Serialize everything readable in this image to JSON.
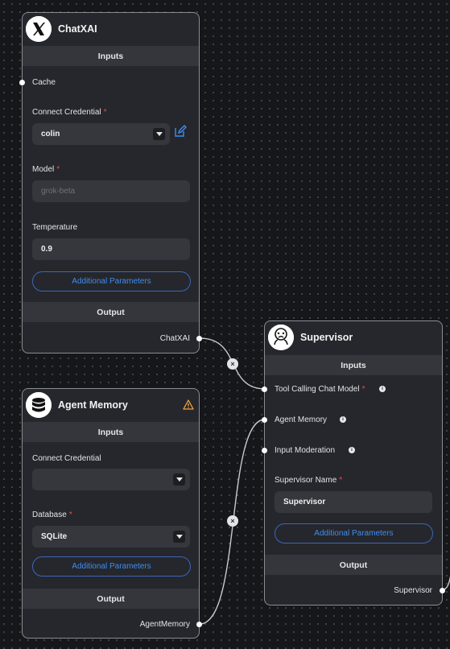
{
  "chatxai": {
    "title": "ChatXAI",
    "inputs_label": "Inputs",
    "cache_label": "Cache",
    "credential_label": "Connect Credential",
    "credential_value": "colin",
    "model_label": "Model",
    "model_value": "grok-beta",
    "temperature_label": "Temperature",
    "temperature_value": "0.9",
    "additional_params": "Additional Parameters",
    "output_label": "Output",
    "output_anchor": "ChatXAI"
  },
  "agent_memory": {
    "title": "Agent Memory",
    "inputs_label": "Inputs",
    "credential_label": "Connect Credential",
    "credential_value": "",
    "database_label": "Database",
    "database_value": "SQLite",
    "additional_params": "Additional Parameters",
    "output_label": "Output",
    "output_anchor": "AgentMemory"
  },
  "supervisor": {
    "title": "Supervisor",
    "inputs_label": "Inputs",
    "tool_model_label": "Tool Calling Chat Model",
    "agent_memory_label": "Agent Memory",
    "input_moderation_label": "Input Moderation",
    "name_label": "Supervisor Name",
    "name_value": "Supervisor",
    "additional_params": "Additional Parameters",
    "output_label": "Output",
    "output_anchor": "Supervisor"
  },
  "required_marker": "*",
  "edge_delete_glyph": "×",
  "colors": {
    "canvas": "#16171a",
    "node_bg": "#25272c",
    "accent": "#3f8cf0",
    "required": "#f04b4b",
    "warning": "#f0a43a"
  }
}
